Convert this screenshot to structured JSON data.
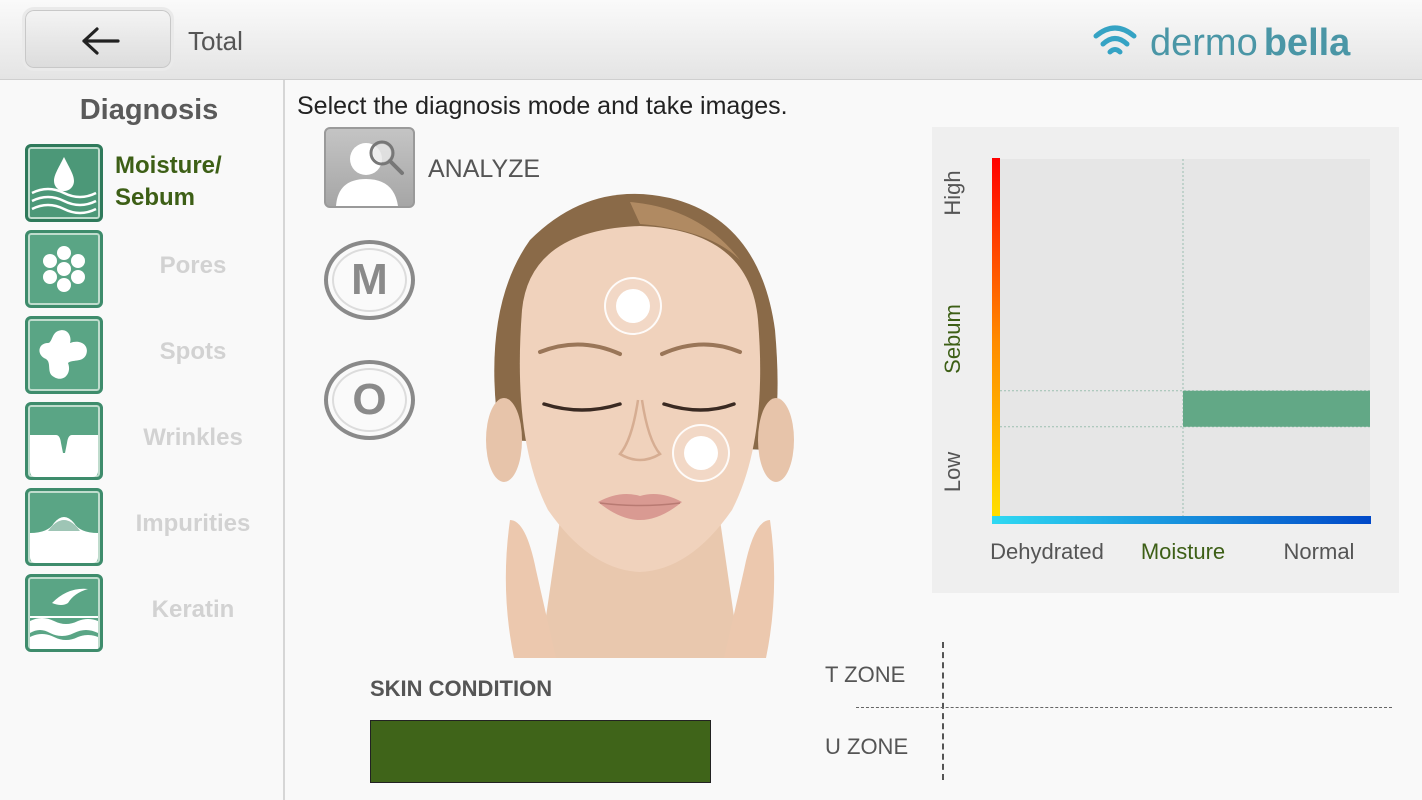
{
  "header": {
    "back_label": "back",
    "title": "Total",
    "brand_part1": "dermo",
    "brand_part2": "bella",
    "brand_icon": "wifi-icon"
  },
  "sidebar": {
    "title": "Diagnosis",
    "items": [
      {
        "label": "Moisture/",
        "label2": "Sebum",
        "icon": "droplet-icon",
        "active": true
      },
      {
        "label": "Pores",
        "icon": "pores-icon",
        "active": false
      },
      {
        "label": "Spots",
        "icon": "spots-icon",
        "active": false
      },
      {
        "label": "Wrinkles",
        "icon": "wrinkles-icon",
        "active": false
      },
      {
        "label": "Impurities",
        "icon": "impurities-icon",
        "active": false
      },
      {
        "label": "Keratin",
        "icon": "keratin-icon",
        "active": false
      }
    ]
  },
  "main": {
    "instruction": "Select the diagnosis mode and take images.",
    "analyze_label": "ANALYZE",
    "mode_m": "M",
    "mode_o": "O",
    "skin_condition_title": "SKIN CONDITION",
    "skin_condition_color": "#3f6419",
    "t_zone": "T ZONE",
    "u_zone": "U ZONE"
  },
  "colors": {
    "accent_green": "#5aa585",
    "active_text": "#3d5f16",
    "brand": "#4a96a6",
    "result_bar": "#62a886"
  },
  "chart_data": {
    "type": "heatmap",
    "x_categories": [
      "Dehydrated",
      "Moisture",
      "Normal"
    ],
    "y_labels": [
      "Low",
      "Sebum",
      "High"
    ],
    "xlabel": "Moisture",
    "ylabel": "Sebum",
    "result": {
      "moisture": "Normal",
      "sebum_level": 0.25
    },
    "grid": true
  }
}
